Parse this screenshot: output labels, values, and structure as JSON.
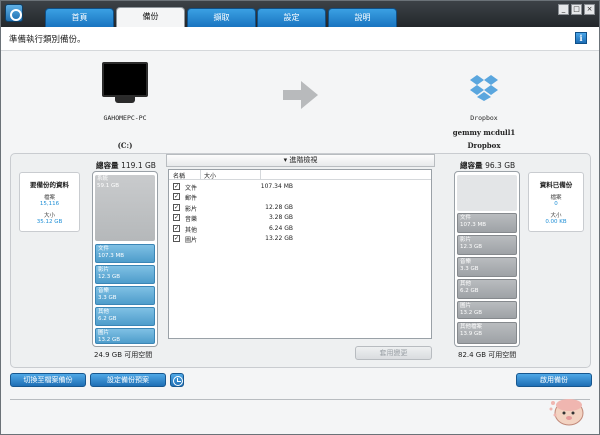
{
  "tabs": [
    "首頁",
    "備份",
    "擷取",
    "設定",
    "說明"
  ],
  "active_tab": "備份",
  "window_controls": [
    "_",
    "□",
    "×"
  ],
  "status_text": "準備執行類別備份。",
  "info_icon": "i",
  "source": {
    "name": "GAHOMEPC-PC",
    "drive": "(C:)",
    "total_label": "總容量",
    "total_value": "119.1 GB",
    "free_text": "24.9 GB 可用空間",
    "segments": [
      {
        "label": "系統",
        "value": "59.1 GB"
      },
      {
        "label": "文件",
        "value": "107.3 MB"
      },
      {
        "label": "影片",
        "value": "12.3 GB"
      },
      {
        "label": "音樂",
        "value": "3.3 GB"
      },
      {
        "label": "其他",
        "value": "6.2 GB"
      },
      {
        "label": "圖片",
        "value": "13.2 GB"
      }
    ]
  },
  "left_summary": {
    "title": "要備份的資料",
    "files_label": "檔案",
    "files_value": "15,116",
    "size_label": "大小",
    "size_value": "35.12 GB"
  },
  "destination": {
    "name": "Dropbox",
    "account": "gemmy mcdull1",
    "service": "Dropbox",
    "total_label": "總容量",
    "total_value": "96.3 GB",
    "free_text": "82.4 GB 可用空間",
    "segments": [
      {
        "label": "文件",
        "value": "107.3 MB"
      },
      {
        "label": "影片",
        "value": "12.3 GB"
      },
      {
        "label": "音樂",
        "value": "3.3 GB"
      },
      {
        "label": "其他",
        "value": "6.2 GB"
      },
      {
        "label": "圖片",
        "value": "13.2 GB"
      },
      {
        "label": "其他檔案",
        "value": "13.9 GB"
      }
    ]
  },
  "right_summary": {
    "title": "資料已備份",
    "files_label": "檔案",
    "files_value": "0",
    "size_label": "大小",
    "size_value": "0.00 KB"
  },
  "advanced": {
    "header": "進階檢視",
    "columns": [
      "名稱",
      "大小"
    ],
    "rows": [
      {
        "name": "文件",
        "size": "107.34 MB",
        "checked": true
      },
      {
        "name": "郵件",
        "size": "",
        "checked": true
      },
      {
        "name": "影片",
        "size": "12.28 GB",
        "checked": true
      },
      {
        "name": "音樂",
        "size": "3.28 GB",
        "checked": true
      },
      {
        "name": "其他",
        "size": "6.24 GB",
        "checked": true
      },
      {
        "name": "圖片",
        "size": "13.22 GB",
        "checked": true
      }
    ],
    "apply_label": "套用變更"
  },
  "buttons": {
    "switch_file_backup": "切換至檔案備份",
    "set_backup_schedule": "設定備份預案",
    "start_backup": "啟用備份"
  },
  "colors": {
    "tab_blue": "#1a74c0",
    "value_blue": "#1f8fd6",
    "segment_blue": "#4e9dcb"
  }
}
